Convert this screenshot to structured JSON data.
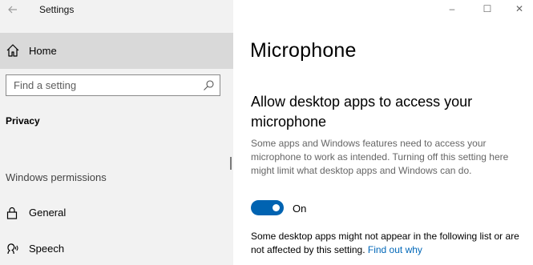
{
  "window": {
    "title": "Settings",
    "controls": {
      "minimize": "–",
      "maximize": "☐",
      "close": "✕"
    }
  },
  "sidebar": {
    "home_label": "Home",
    "search_placeholder": "Find a setting",
    "section_title": "Privacy",
    "group_title": "Windows permissions",
    "items": [
      {
        "label": "General",
        "icon": "lock-icon"
      },
      {
        "label": "Speech",
        "icon": "speech-icon"
      }
    ]
  },
  "main": {
    "title": "Microphone",
    "subheading": "Allow desktop apps to access your microphone",
    "description": "Some apps and Windows features need to access your microphone to work as intended. Turning off this setting here might limit what desktop apps and Windows can do.",
    "toggle_state": "On",
    "note_text": "Some desktop apps might not appear in the following list or are not affected by this setting. ",
    "note_link": "Find out why"
  },
  "colors": {
    "accent": "#0063b1",
    "link": "#0067b8",
    "sidebar_bg": "#f2f2f2",
    "selected_bg": "#d9d9d9"
  }
}
